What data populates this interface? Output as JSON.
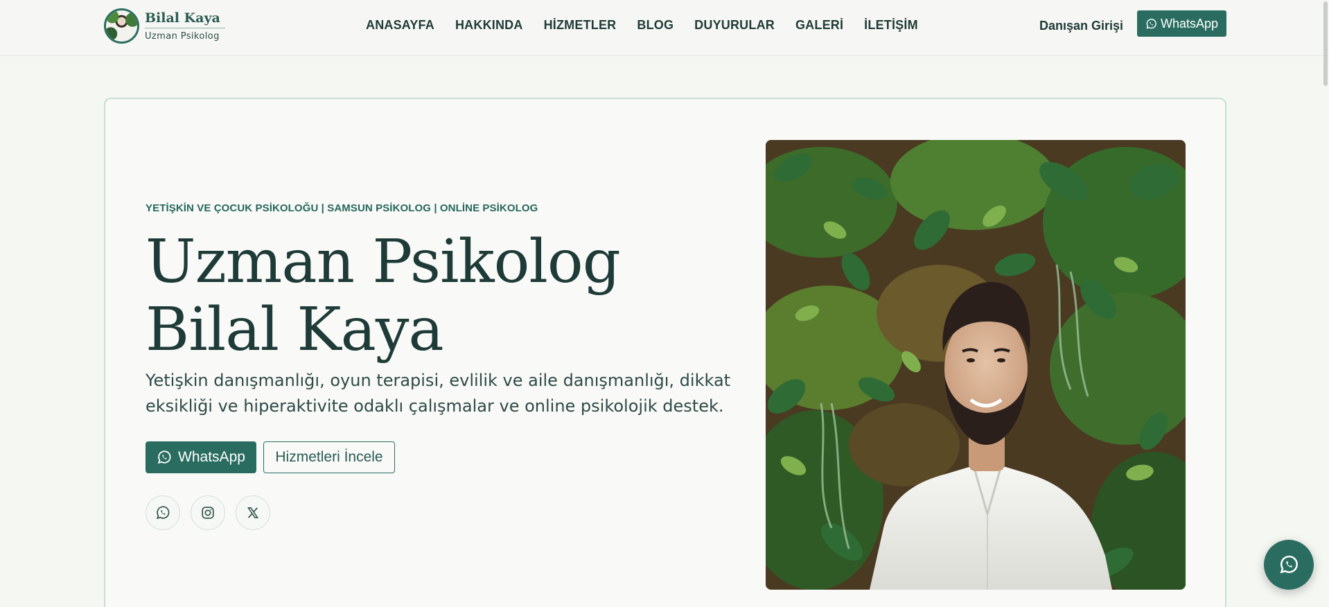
{
  "brand": {
    "name": "Bilal Kaya",
    "subtitle": "Uzman Psikolog"
  },
  "nav": {
    "items": [
      {
        "label": "ANASAYFA"
      },
      {
        "label": "HAKKINDA"
      },
      {
        "label": "HİZMETLER"
      },
      {
        "label": "BLOG"
      },
      {
        "label": "DUYURULAR"
      },
      {
        "label": "GALERİ"
      },
      {
        "label": "İLETİŞİM"
      }
    ],
    "client_login": "Danışan Girişi",
    "whatsapp": "WhatsApp"
  },
  "hero": {
    "eyebrow": "YETİŞKİN VE ÇOCUK PSİKOLOĞU | SAMSUN PSİKOLOG | ONLİNE PSİKOLOG",
    "title": "Uzman Psikolog Bilal Kaya",
    "lead": "Yetişkin danışmanlığı, oyun terapisi, evlilik ve aile danışmanlığı, dikkat eksikliği ve hiperaktivite odaklı çalışmalar ve online psikolojik destek.",
    "whatsapp_button": "WhatsApp",
    "services_button": "Hizmetleri İncele",
    "social": [
      "whatsapp-icon",
      "instagram-icon",
      "x-icon"
    ]
  },
  "colors": {
    "accent": "#2a6d60",
    "text": "#1f3b38",
    "background": "#f5f7f3"
  }
}
